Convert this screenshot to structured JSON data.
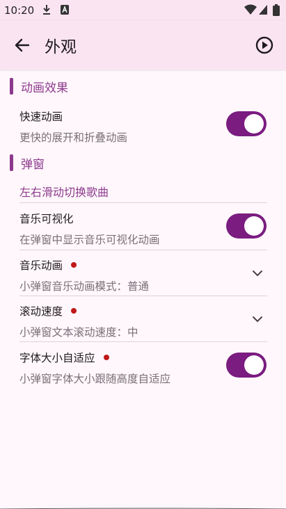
{
  "status_bar": {
    "time": "10:20",
    "left_icons": [
      "download-icon",
      "app-a-icon"
    ],
    "right_icons": [
      "wifi-icon",
      "signal-icon",
      "battery-icon"
    ]
  },
  "app_bar": {
    "title": "外观",
    "back_icon": "arrow-back-icon",
    "action_icon": "play-circle-icon"
  },
  "sections": {
    "animation": {
      "title": "动画效果",
      "fast_anim": {
        "title": "快速动画",
        "subtitle": "更快的展开和折叠动画",
        "enabled": true
      }
    },
    "popup": {
      "title": "弹窗",
      "swipe_link": "左右滑动切换歌曲",
      "visualizer": {
        "title": "音乐可视化",
        "subtitle": "在弹窗中显示音乐可视化动画",
        "enabled": true
      },
      "music_anim": {
        "title": "音乐动画",
        "subtitle": "小弹窗音乐动画模式：普通"
      },
      "scroll_speed": {
        "title": "滚动速度",
        "subtitle": "小弹窗文本滚动速度：中"
      },
      "font_adapt": {
        "title": "字体大小自适应",
        "subtitle": "小弹窗字体大小跟随高度自适应",
        "enabled": true
      }
    }
  },
  "colors": {
    "accent": "#8c3a8e",
    "toggle_on": "#7a1c80",
    "app_bar_bg": "#fbe4f2",
    "page_bg": "#fff7fb",
    "new_dot": "#c01818"
  }
}
